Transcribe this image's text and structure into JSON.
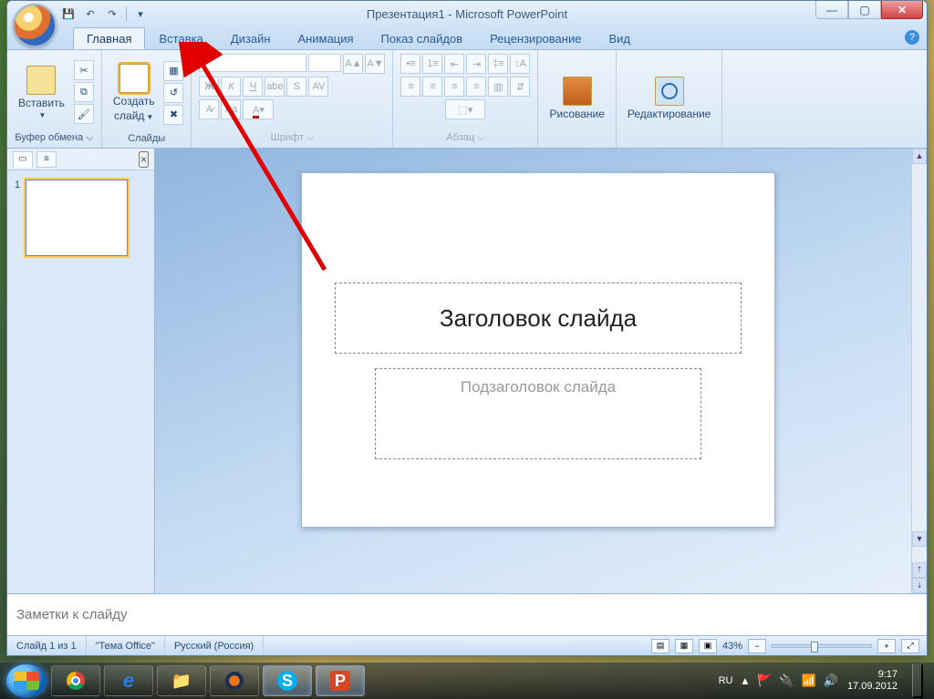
{
  "window_title": "Презентация1 - Microsoft PowerPoint",
  "tabs": {
    "home": "Главная",
    "insert": "Вставка",
    "design": "Дизайн",
    "animation": "Анимация",
    "slideshow": "Показ слайдов",
    "review": "Рецензирование",
    "view": "Вид"
  },
  "ribbon": {
    "paste": "Вставить",
    "clipboard_label": "Буфер обмена",
    "new_slide_line1": "Создать",
    "new_slide_line2": "слайд",
    "slides_label": "Слайды",
    "font_label": "Шрифт",
    "paragraph_label": "Абзац",
    "drawing": "Рисование",
    "editing": "Редактирование"
  },
  "slide": {
    "number": "1",
    "title_placeholder": "Заголовок слайда",
    "subtitle_placeholder": "Подзаголовок слайда"
  },
  "notes_placeholder": "Заметки к слайду",
  "status": {
    "slide_counter": "Слайд 1 из 1",
    "theme": "\"Тема Office\"",
    "language": "Русский (Россия)",
    "zoom": "43%"
  },
  "tray": {
    "lang": "RU",
    "time": "9:17",
    "date": "17.09.2012"
  }
}
